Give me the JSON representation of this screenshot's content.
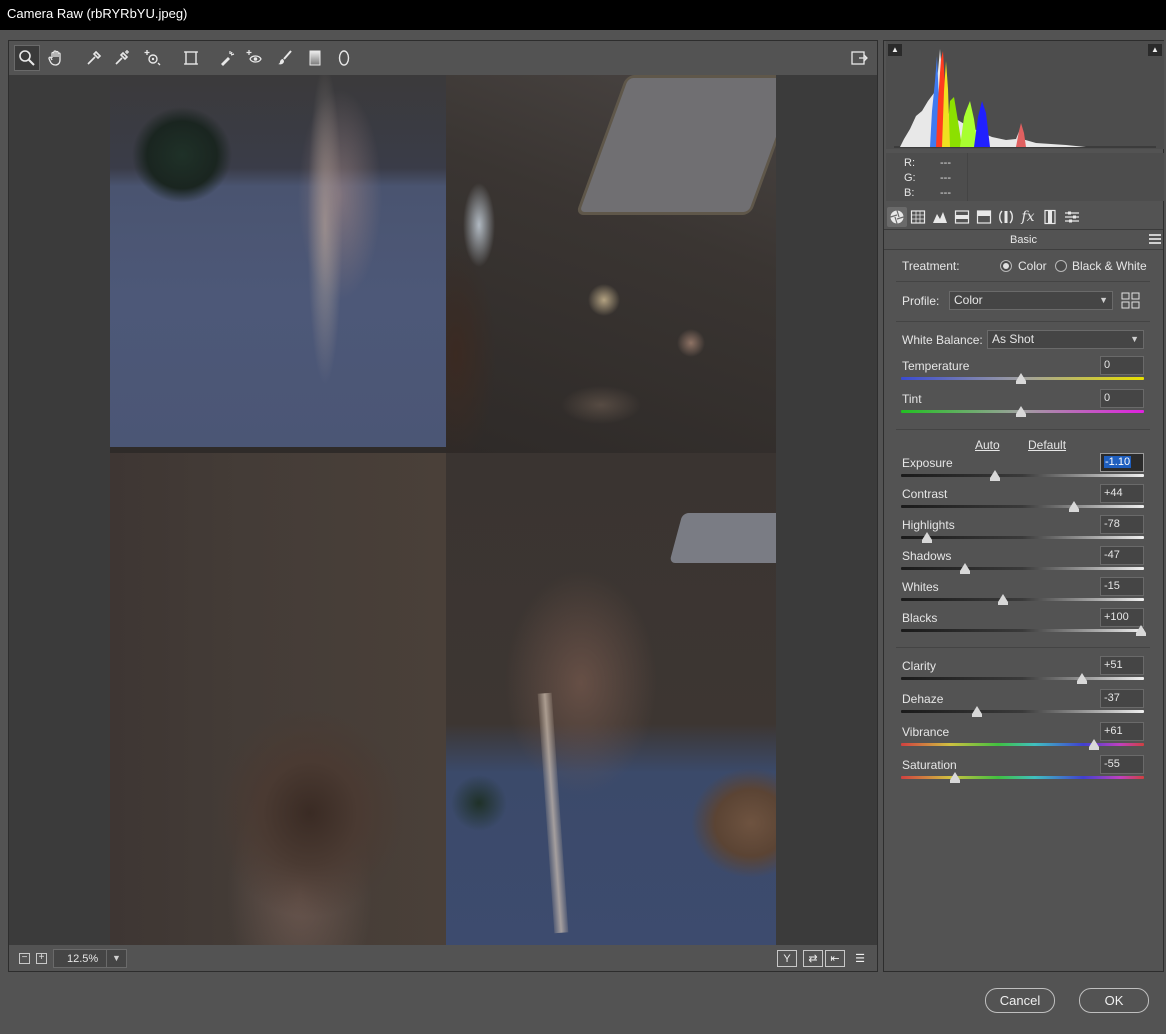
{
  "window": {
    "title": "Camera Raw (rbRYRbYU.jpeg)"
  },
  "toolbar": {
    "tools": [
      "zoom-tool-icon",
      "hand-tool-icon",
      "white-balance-tool-icon",
      "color-sampler-tool-icon",
      "targeted-adjustment-tool-icon",
      "transform-tool-icon",
      "spot-removal-tool-icon",
      "red-eye-removal-icon",
      "adjustment-brush-icon",
      "graduated-filter-icon",
      "radial-filter-icon"
    ],
    "open_preferences": "open-preferences-icon"
  },
  "bottom_bar": {
    "zoom_value": "12.5%",
    "zoom_out": "−",
    "zoom_in": "+",
    "before_after_label": "Y",
    "swap_label": "⇄",
    "copy_label": "⇤",
    "settings_label": "☰"
  },
  "histogram": {
    "r_label": "R:",
    "r_value": "---",
    "g_label": "G:",
    "g_value": "---",
    "b_label": "B:",
    "b_value": "---"
  },
  "panel": {
    "title": "Basic",
    "treatment_label": "Treatment:",
    "treatment_color": "Color",
    "treatment_bw": "Black & White",
    "treatment_selected": "Color",
    "profile_label": "Profile:",
    "profile_value": "Color",
    "white_balance_label": "White Balance:",
    "white_balance_value": "As Shot",
    "auto_label": "Auto",
    "default_label": "Default"
  },
  "sliders": [
    {
      "id": "temperature",
      "label": "Temperature",
      "value": "0",
      "min": -100,
      "max": 100,
      "num": 0,
      "track": "temp"
    },
    {
      "id": "tint",
      "label": "Tint",
      "value": "0",
      "min": -150,
      "max": 150,
      "num": 0,
      "track": "tint"
    },
    {
      "id": "exposure",
      "label": "Exposure",
      "value": "-1.10",
      "min": -5,
      "max": 5,
      "num": -1.1,
      "track": "gray",
      "focused": true
    },
    {
      "id": "contrast",
      "label": "Contrast",
      "value": "+44",
      "min": -100,
      "max": 100,
      "num": 44,
      "track": "gray"
    },
    {
      "id": "highlights",
      "label": "Highlights",
      "value": "-78",
      "min": -100,
      "max": 100,
      "num": -78,
      "track": "gray"
    },
    {
      "id": "shadows",
      "label": "Shadows",
      "value": "-47",
      "min": -100,
      "max": 100,
      "num": -47,
      "track": "gray"
    },
    {
      "id": "whites",
      "label": "Whites",
      "value": "-15",
      "min": -100,
      "max": 100,
      "num": -15,
      "track": "gray"
    },
    {
      "id": "blacks",
      "label": "Blacks",
      "value": "+100",
      "min": -100,
      "max": 100,
      "num": 100,
      "track": "gray"
    },
    {
      "id": "clarity",
      "label": "Clarity",
      "value": "+51",
      "min": -100,
      "max": 100,
      "num": 51,
      "track": "gray"
    },
    {
      "id": "dehaze",
      "label": "Dehaze",
      "value": "-37",
      "min": -100,
      "max": 100,
      "num": -37,
      "track": "gray"
    },
    {
      "id": "vibrance",
      "label": "Vibrance",
      "value": "+61",
      "min": -100,
      "max": 100,
      "num": 61,
      "track": "spectrum"
    },
    {
      "id": "saturation",
      "label": "Saturation",
      "value": "-55",
      "min": -100,
      "max": 100,
      "num": -55,
      "track": "spectrum"
    }
  ],
  "panel_tabs": [
    "basic-tab-icon",
    "tone-curve-tab-icon",
    "detail-tab-icon",
    "hsl-tab-icon",
    "split-toning-tab-icon",
    "lens-corrections-tab-icon",
    "effects-tab-icon",
    "camera-calibration-tab-icon",
    "presets-tab-icon"
  ],
  "footer": {
    "cancel_label": "Cancel",
    "ok_label": "OK"
  },
  "colors": {
    "background": "#535353",
    "titlebar": "#000000",
    "focus": "#1f5fbf"
  }
}
